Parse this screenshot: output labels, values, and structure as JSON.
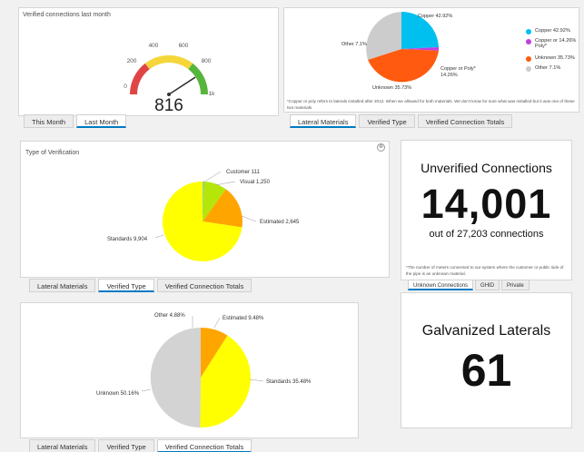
{
  "gauge_panel": {
    "title": "Verified connections last month",
    "ticks": [
      "0",
      "200",
      "400",
      "600",
      "800",
      "1k"
    ],
    "value": 816,
    "value_label": "816",
    "max": 1000,
    "tabs": [
      {
        "label": "This Month",
        "active": false
      },
      {
        "label": "Last Month",
        "active": true
      }
    ]
  },
  "materials_panel": {
    "slice_labels": [
      "Copper 42.92%",
      "Copper or Poly*",
      "14.26%",
      "Unknown 35.73%",
      "Other 7.1%"
    ],
    "legend": [
      {
        "label": "Copper  42.92%",
        "color": "#00c0f0"
      },
      {
        "label": "Copper or  14.26%",
        "label2": "Poly*",
        "color": "#c040e0"
      },
      {
        "label": "Unknown  35.73%",
        "color": "#ff5a10"
      },
      {
        "label": "Other  7.1%",
        "color": "#cccccc"
      }
    ],
    "footnote": "*Copper or poly refers to laterals installed after 2012. When we allowed for both materials.  We don't know for sure what was installed but it was one of these two materials.",
    "tabs": [
      {
        "label": "Lateral Materials",
        "active": true
      },
      {
        "label": "Verified Type",
        "active": false
      },
      {
        "label": "Verified Connection Totals",
        "active": false
      }
    ]
  },
  "verification_panel": {
    "title": "Type of Verification",
    "labels": [
      "Customer 111",
      "Visual 1,250",
      "Estimated 2,645",
      "Standards 9,904"
    ],
    "tabs": [
      {
        "label": "Lateral Materials",
        "active": false
      },
      {
        "label": "Verified Type",
        "active": true
      },
      {
        "label": "Verified Connection Totals",
        "active": false
      }
    ]
  },
  "totals_panel": {
    "labels": [
      "Other 4.88%",
      "Estimated 9.48%",
      "Standards 35.48%",
      "Unknown 50.16%"
    ],
    "tabs": [
      {
        "label": "Lateral Materials",
        "active": false
      },
      {
        "label": "Verified Type",
        "active": false
      },
      {
        "label": "Verified Connection Totals",
        "active": true
      }
    ]
  },
  "unverified_panel": {
    "title": "Unverified Connections",
    "value": "14,001",
    "subtitle": "out of 27,203 connections",
    "footnote": "*The number of meters connected to our system where the customer or public side of the pipe is an unknown material.",
    "tabs": [
      {
        "label": "Unknown Connections",
        "active": true
      },
      {
        "label": "GHID",
        "active": false
      },
      {
        "label": "Private",
        "active": false
      }
    ]
  },
  "galvanized_panel": {
    "title": "Galvanized Laterals",
    "value": "61"
  },
  "chart_data": [
    {
      "type": "pie",
      "title": "",
      "categories": [
        "Copper",
        "Copper or Poly*",
        "Unknown",
        "Other"
      ],
      "values": [
        42.92,
        14.26,
        35.73,
        7.1
      ],
      "colors": [
        "#00c0f0",
        "#c040e0",
        "#ff5a10",
        "#cccccc"
      ],
      "legend": "right"
    },
    {
      "type": "pie",
      "title": "Type of Verification",
      "categories": [
        "Customer",
        "Visual",
        "Estimated",
        "Standards"
      ],
      "values": [
        111,
        1250,
        2645,
        9904
      ],
      "colors": [
        "#8fd680",
        "#b4e60a",
        "#ffa500",
        "#ffff00"
      ]
    },
    {
      "type": "pie",
      "title": "",
      "categories": [
        "Other",
        "Estimated",
        "Standards",
        "Unknown"
      ],
      "values": [
        4.88,
        9.48,
        35.48,
        50.16
      ],
      "colors": [
        "#ffa500",
        "#ffa500",
        "#ffff00",
        "#d3d3d3"
      ]
    }
  ]
}
